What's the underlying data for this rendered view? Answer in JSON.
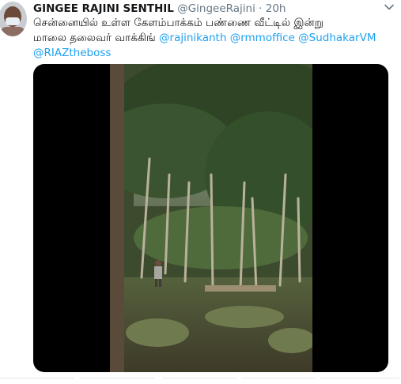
{
  "tweet": {
    "author_name": "GINGEE RAJINI SENTHIL",
    "author_handle": "@GingeeRajini",
    "separator": "·",
    "time": "20h",
    "text_line1": "சென்னையில் உள்ள கேளம்பாக்கம் பண்ணை வீட்டில் இன்று",
    "text_line2_prefix": "மாலை தலைவர் வாக்கிங் ",
    "mentions": [
      "@rajinikanth",
      "@rmmoffice",
      "@SudhakarVM",
      "@RIAZtheboss"
    ]
  },
  "icons": {
    "menu": "chevron-down-icon",
    "avatar": "profile-avatar"
  },
  "colors": {
    "link": "#1da1f2",
    "muted": "#657786",
    "text": "#14171a"
  }
}
